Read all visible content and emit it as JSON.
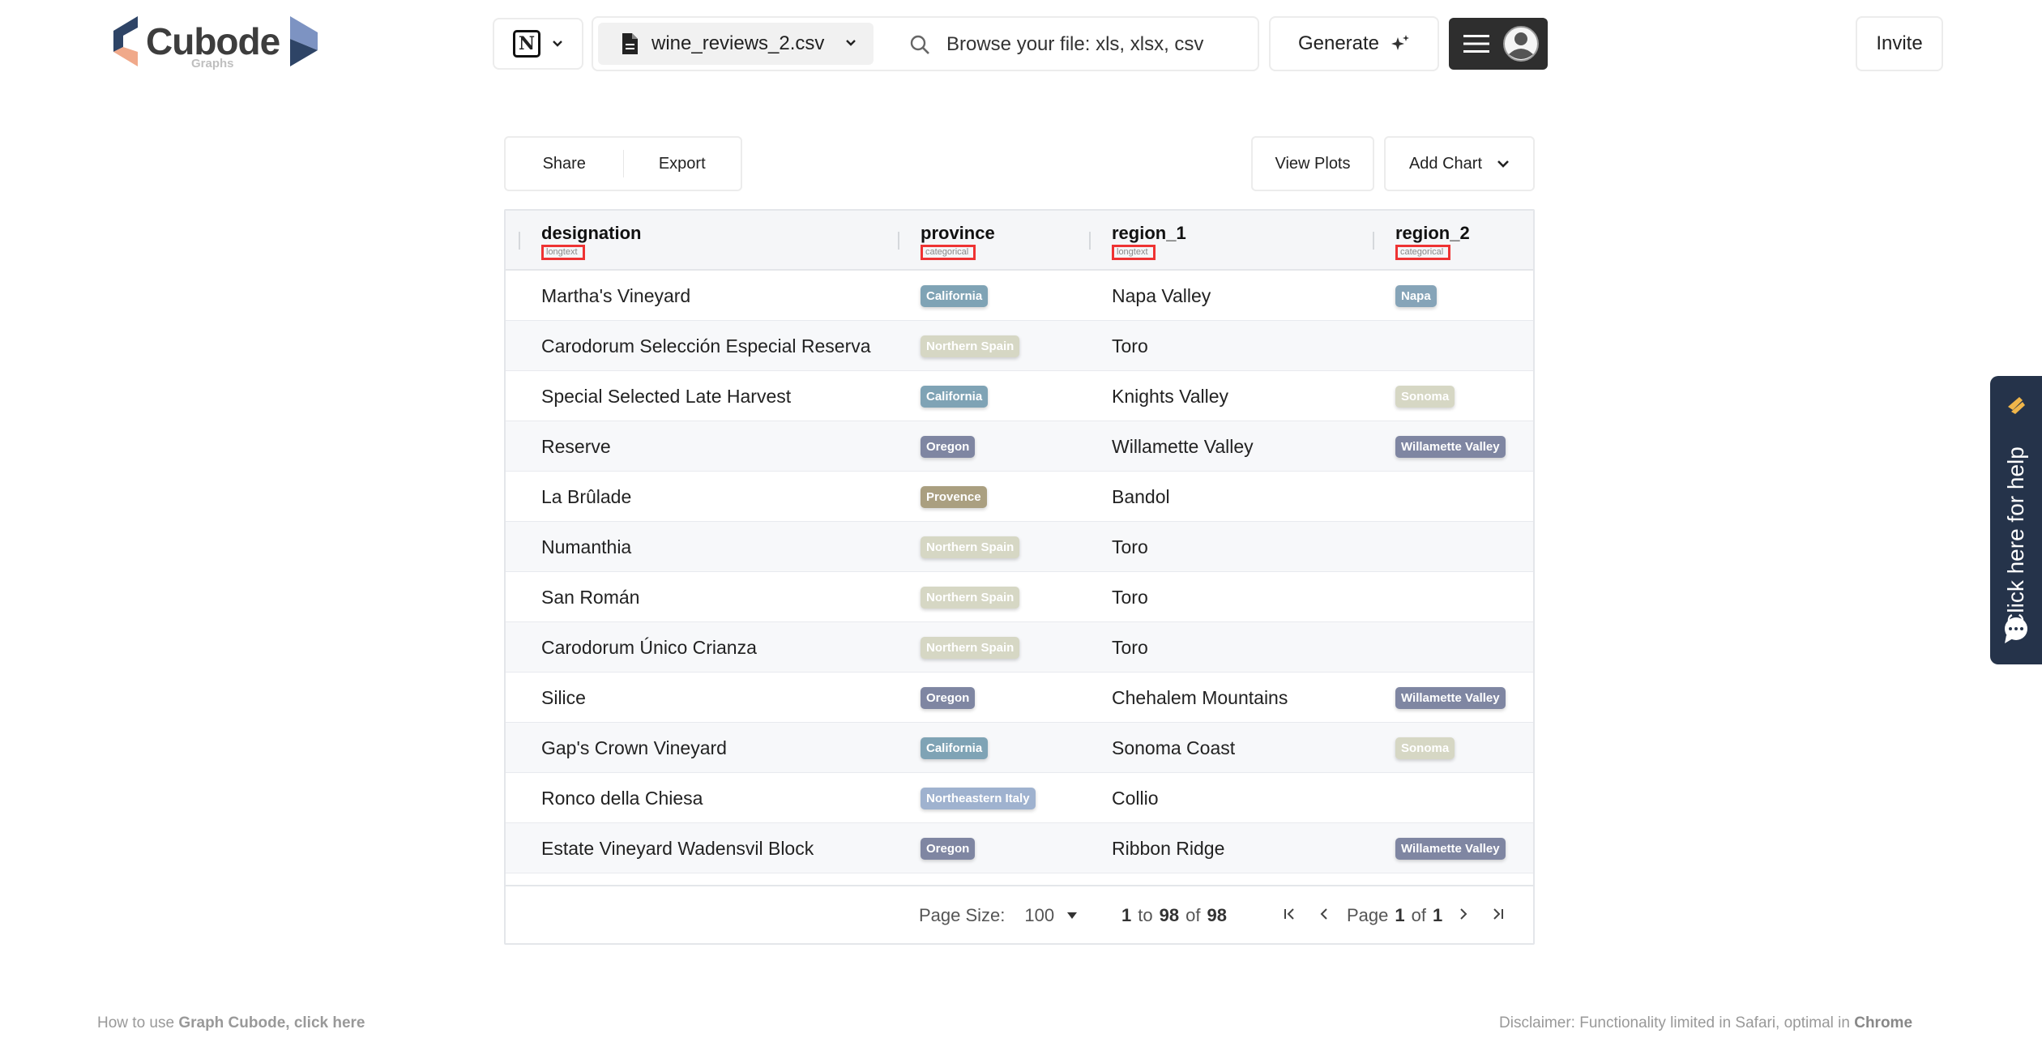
{
  "brand": {
    "name": "Cubode",
    "sub": "Graphs"
  },
  "topbar": {
    "file_name": "wine_reviews_2.csv",
    "search_placeholder": "Browse your file: xls, xlsx, csv",
    "generate_label": "Generate",
    "invite_label": "Invite"
  },
  "toolbar": {
    "share_label": "Share",
    "export_label": "Export",
    "view_plots_label": "View Plots",
    "add_chart_label": "Add Chart"
  },
  "table": {
    "columns": [
      {
        "name": "designation",
        "type": "longtext"
      },
      {
        "name": "province",
        "type": "categorical"
      },
      {
        "name": "region_1",
        "type": "longtext"
      },
      {
        "name": "region_2",
        "type": "categorical"
      }
    ],
    "rows": [
      {
        "designation": "Martha's Vineyard",
        "province": "California",
        "region_1": "Napa Valley",
        "region_2": "Napa"
      },
      {
        "designation": "Carodorum Selección Especial Reserva",
        "province": "Northern Spain",
        "region_1": "Toro",
        "region_2": ""
      },
      {
        "designation": "Special Selected Late Harvest",
        "province": "California",
        "region_1": "Knights Valley",
        "region_2": "Sonoma"
      },
      {
        "designation": "Reserve",
        "province": "Oregon",
        "region_1": "Willamette Valley",
        "region_2": "Willamette Valley"
      },
      {
        "designation": "La Brûlade",
        "province": "Provence",
        "region_1": "Bandol",
        "region_2": ""
      },
      {
        "designation": "Numanthia",
        "province": "Northern Spain",
        "region_1": "Toro",
        "region_2": ""
      },
      {
        "designation": "San Román",
        "province": "Northern Spain",
        "region_1": "Toro",
        "region_2": ""
      },
      {
        "designation": "Carodorum Único Crianza",
        "province": "Northern Spain",
        "region_1": "Toro",
        "region_2": ""
      },
      {
        "designation": "Silice",
        "province": "Oregon",
        "region_1": "Chehalem Mountains",
        "region_2": "Willamette Valley"
      },
      {
        "designation": "Gap's Crown Vineyard",
        "province": "California",
        "region_1": "Sonoma Coast",
        "region_2": "Sonoma"
      },
      {
        "designation": "Ronco della Chiesa",
        "province": "Northeastern Italy",
        "region_1": "Collio",
        "region_2": ""
      },
      {
        "designation": "Estate Vineyard Wadensvil Block",
        "province": "Oregon",
        "region_1": "Ribbon Ridge",
        "region_2": "Willamette Valley"
      }
    ],
    "badge_colors": {
      "California": "#7fa3b5",
      "Northern Spain": "#d6d7c4",
      "Oregon": "#7f86a2",
      "Provence": "#aa9f80",
      "Northeastern Italy": "#9fb2cf",
      "Napa": "#86a4b8",
      "Sonoma": "#d6d7c4",
      "Willamette Valley": "#7f86a2"
    }
  },
  "pagination": {
    "page_size_label": "Page Size:",
    "page_size": "100",
    "range_from": "1",
    "range_to_word": "to",
    "range_to": "98",
    "of_word": "of",
    "total": "98",
    "page_word": "Page",
    "page": "1",
    "page_count": "1"
  },
  "help": {
    "label": "Click here for help"
  },
  "footer": {
    "left_prefix": "How to use ",
    "left_link": "Graph Cubode, click here",
    "right_prefix": "Disclaimer: Functionality limited in Safari, optimal in ",
    "right_link": "Chrome"
  }
}
